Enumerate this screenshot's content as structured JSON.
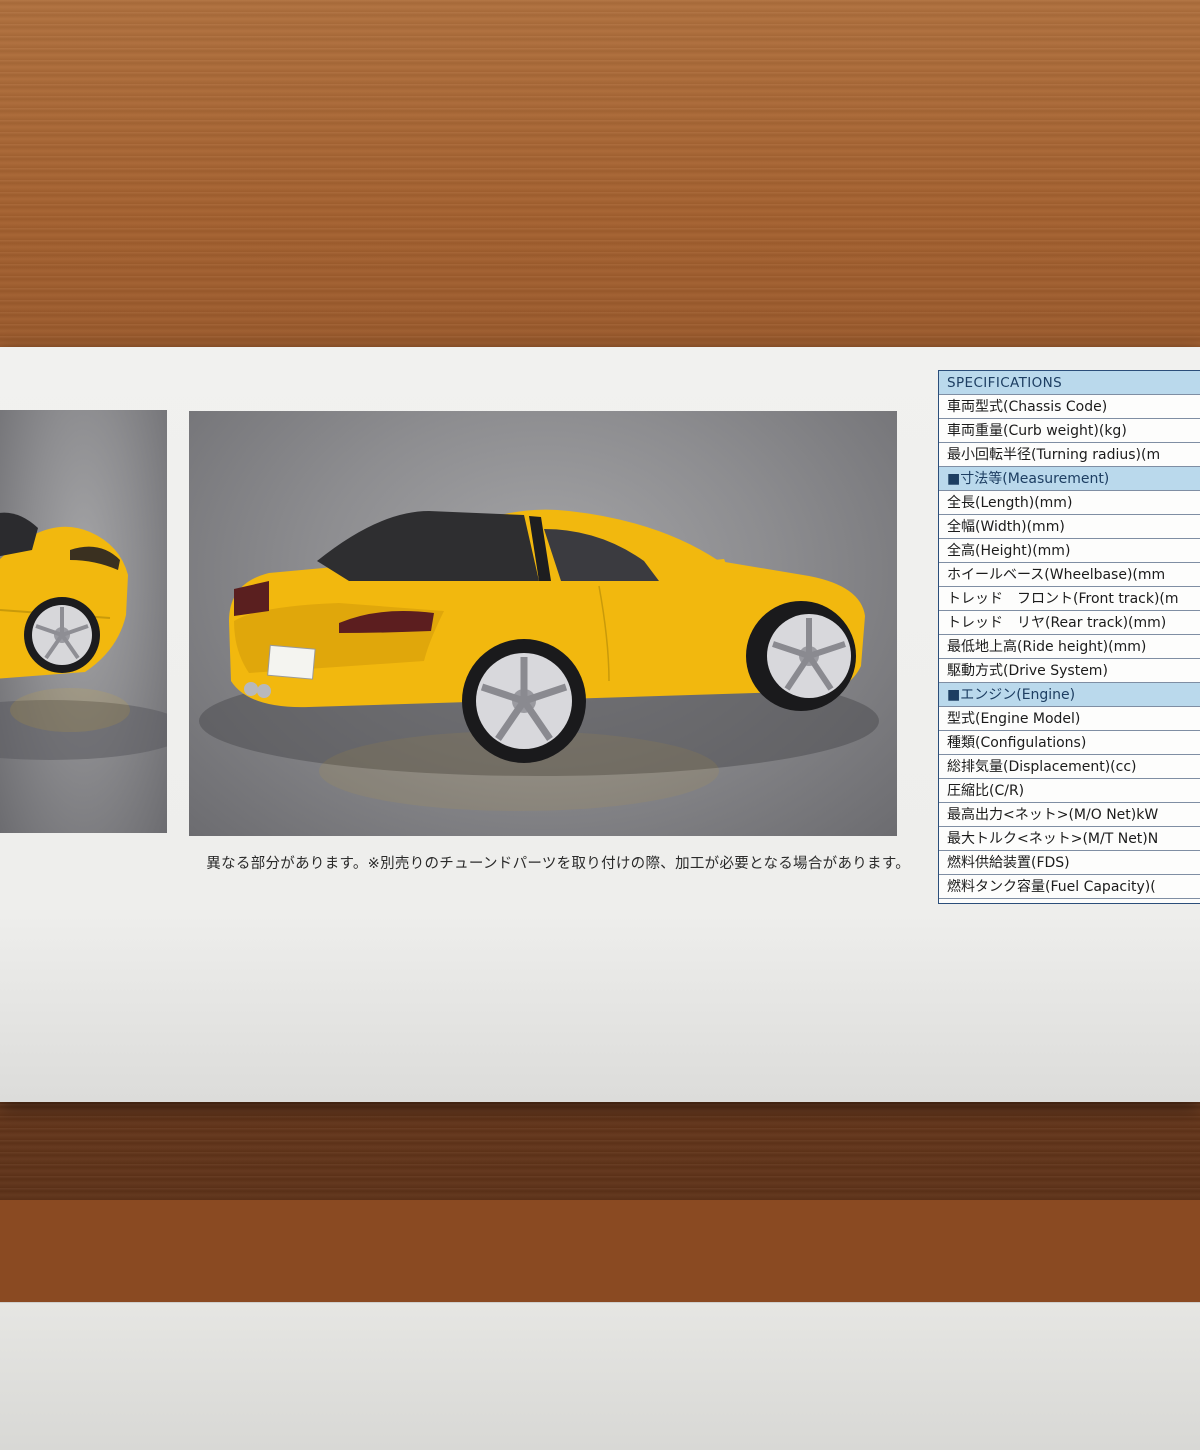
{
  "disclaimer": "異なる部分があります。※別売りのチューンドパーツを取り付けの際、加工が必要となる場合があります。",
  "specifications": {
    "header": "SPECIFICATIONS",
    "rows": [
      {
        "label": "車両型式(Chassis Code)",
        "type": "item"
      },
      {
        "label": "車両重量(Curb weight)(kg)",
        "type": "item"
      },
      {
        "label": "最小回転半径(Turning radius)(m",
        "type": "item"
      },
      {
        "label": "■寸法等(Measurement)",
        "type": "section"
      },
      {
        "label": "全長(Length)(mm)",
        "type": "item"
      },
      {
        "label": "全幅(Width)(mm)",
        "type": "item"
      },
      {
        "label": "全高(Height)(mm)",
        "type": "item"
      },
      {
        "label": "ホイールベース(Wheelbase)(mm",
        "type": "item"
      },
      {
        "label": "トレッド　フロント(Front track)(m",
        "type": "item"
      },
      {
        "label": "トレッド　リヤ(Rear track)(mm)",
        "type": "item"
      },
      {
        "label": "最低地上高(Ride height)(mm)",
        "type": "item"
      },
      {
        "label": "駆動方式(Drive System)",
        "type": "item"
      },
      {
        "label": "■エンジン(Engine)",
        "type": "section"
      },
      {
        "label": "型式(Engine Model)",
        "type": "item"
      },
      {
        "label": "種類(Configulations)",
        "type": "item"
      },
      {
        "label": "総排気量(Displacement)(cc)",
        "type": "item"
      },
      {
        "label": "圧縮比(C/R)",
        "type": "item"
      },
      {
        "label": "最高出力<ネット>(M/O Net)kW",
        "type": "item"
      },
      {
        "label": "最大トルク<ネット>(M/T Net)N",
        "type": "item"
      },
      {
        "label": "燃料供給装置(FDS)",
        "type": "item"
      },
      {
        "label": "燃料タンク容量(Fuel Capacity)(",
        "type": "item"
      }
    ]
  },
  "colors": {
    "car_body": "#f2b80e",
    "spec_header": "#bad9ec",
    "spec_border": "#2b4e7a"
  }
}
